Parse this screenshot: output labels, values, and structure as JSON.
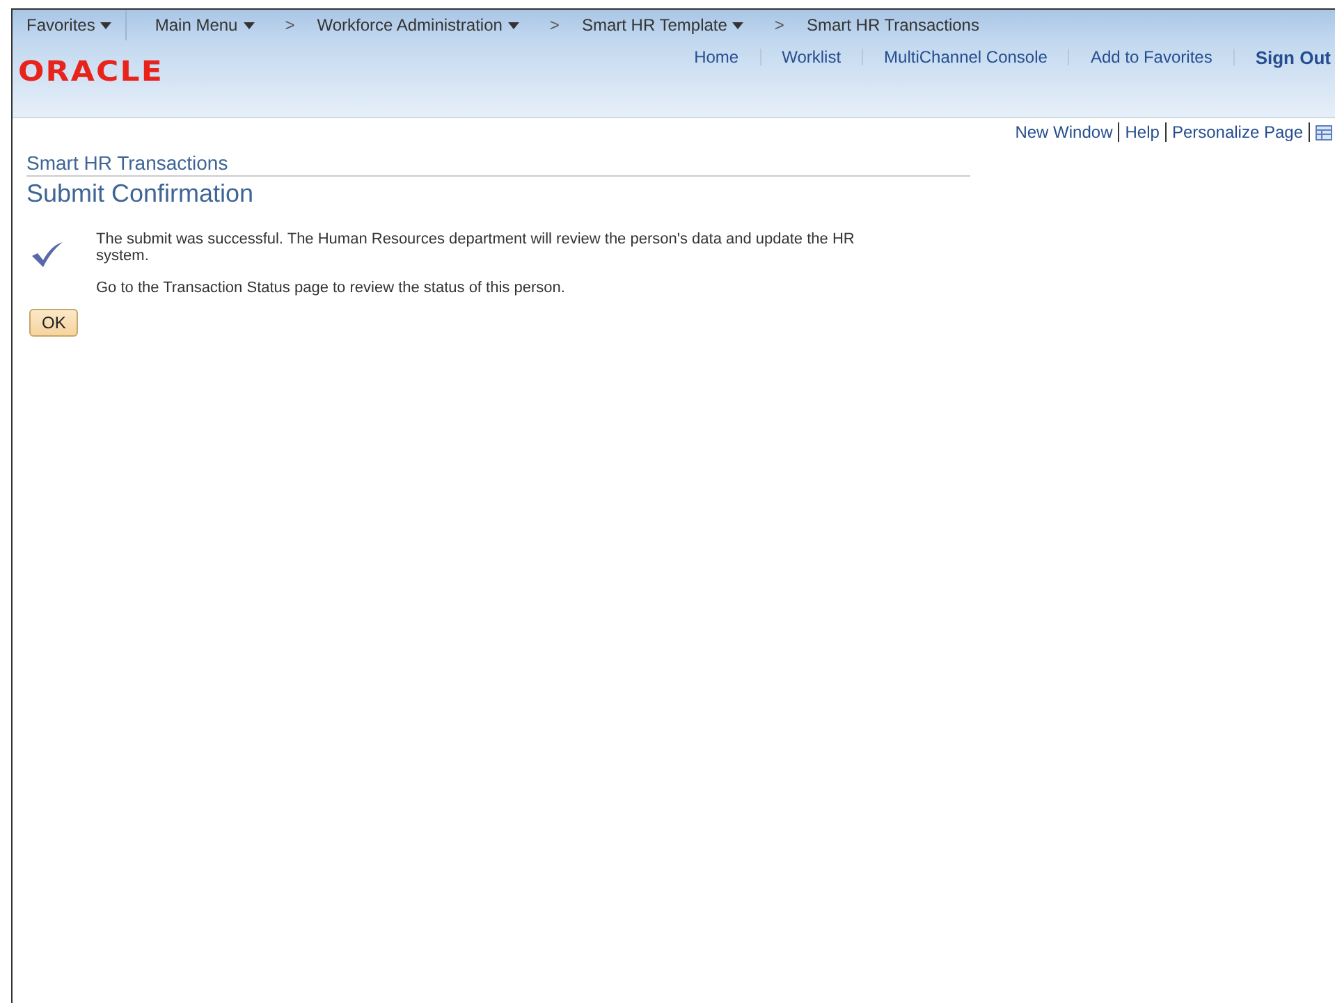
{
  "breadcrumbs": [
    {
      "label": "Favorites",
      "dropdown": true
    },
    {
      "label": "Main Menu",
      "dropdown": true
    },
    {
      "label": "Workforce Administration",
      "dropdown": true,
      "separator": ">"
    },
    {
      "label": "Smart HR Template",
      "dropdown": true,
      "separator": ">"
    },
    {
      "label": "Smart HR Transactions",
      "dropdown": false,
      "separator": ">"
    }
  ],
  "logo": "ORACLE",
  "header_links": [
    {
      "label": "Home",
      "bold": false
    },
    {
      "label": "Worklist",
      "bold": false
    },
    {
      "label": "MultiChannel Console",
      "bold": false
    },
    {
      "label": "Add to Favorites",
      "bold": false
    },
    {
      "label": "Sign Out",
      "bold": true
    }
  ],
  "page_links": [
    "New Window",
    "Help",
    "Personalize Page"
  ],
  "component_title": "Smart HR Transactions",
  "page_title": "Submit Confirmation",
  "messages": [
    "The submit was successful. The Human Resources department will review the person's data and update the HR system.",
    "Go to the Transaction Status page to review the status of this person."
  ],
  "ok_button": "OK"
}
